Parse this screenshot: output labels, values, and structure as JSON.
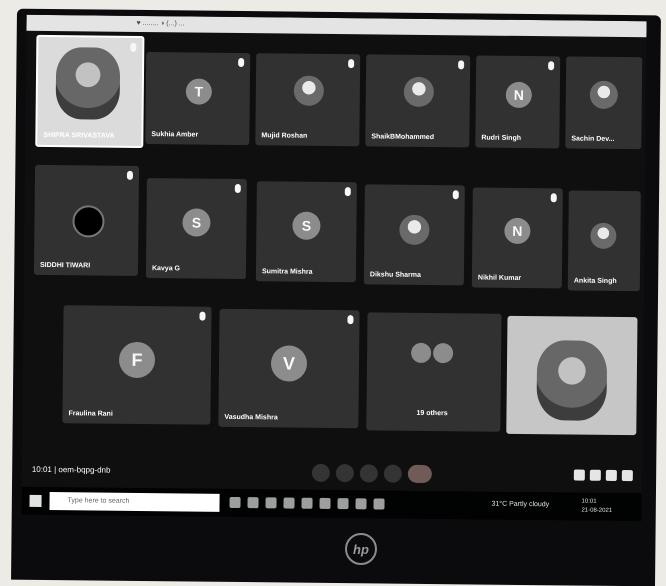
{
  "browser": {
    "tab_text": "♥ ........  ◑ (...) ..."
  },
  "tiles": {
    "t1": {
      "name": "SHIPRA SRIVASTAVA"
    },
    "t2": {
      "name": "Sukhia Amber",
      "initial": "T"
    },
    "t3": {
      "name": "Mujid Roshan"
    },
    "t4": {
      "name": "ShaikBMohammed"
    },
    "t5": {
      "name": "Rudri Singh",
      "initial": "N"
    },
    "t6": {
      "name": "Sachin Dev..."
    },
    "t7": {
      "name": "SIDDHI TIWARI"
    },
    "t8": {
      "name": "Kavya G",
      "initial": "S"
    },
    "t9": {
      "name": "Sumitra Mishra",
      "initial": "S"
    },
    "t10": {
      "name": "Dikshu Sharma"
    },
    "t11": {
      "name": "Nikhil Kumar",
      "initial": "N"
    },
    "t12": {
      "name": "Ankita Singh"
    },
    "t13": {
      "name": "Fraulina Rani",
      "initial": "F"
    },
    "t14": {
      "name": "Vasudha Mishra",
      "initial": "V"
    },
    "t15": {
      "name": "19 others"
    },
    "t16": {
      "name": ""
    }
  },
  "controls": {
    "meeting": "10:01 | oem-bqpg-dnb"
  },
  "taskbar": {
    "search_placeholder": "Type here to search",
    "weather": "31°C Partly cloudy",
    "time": "10:01",
    "date": "21-08-2021"
  },
  "device": {
    "logo": "hp"
  }
}
